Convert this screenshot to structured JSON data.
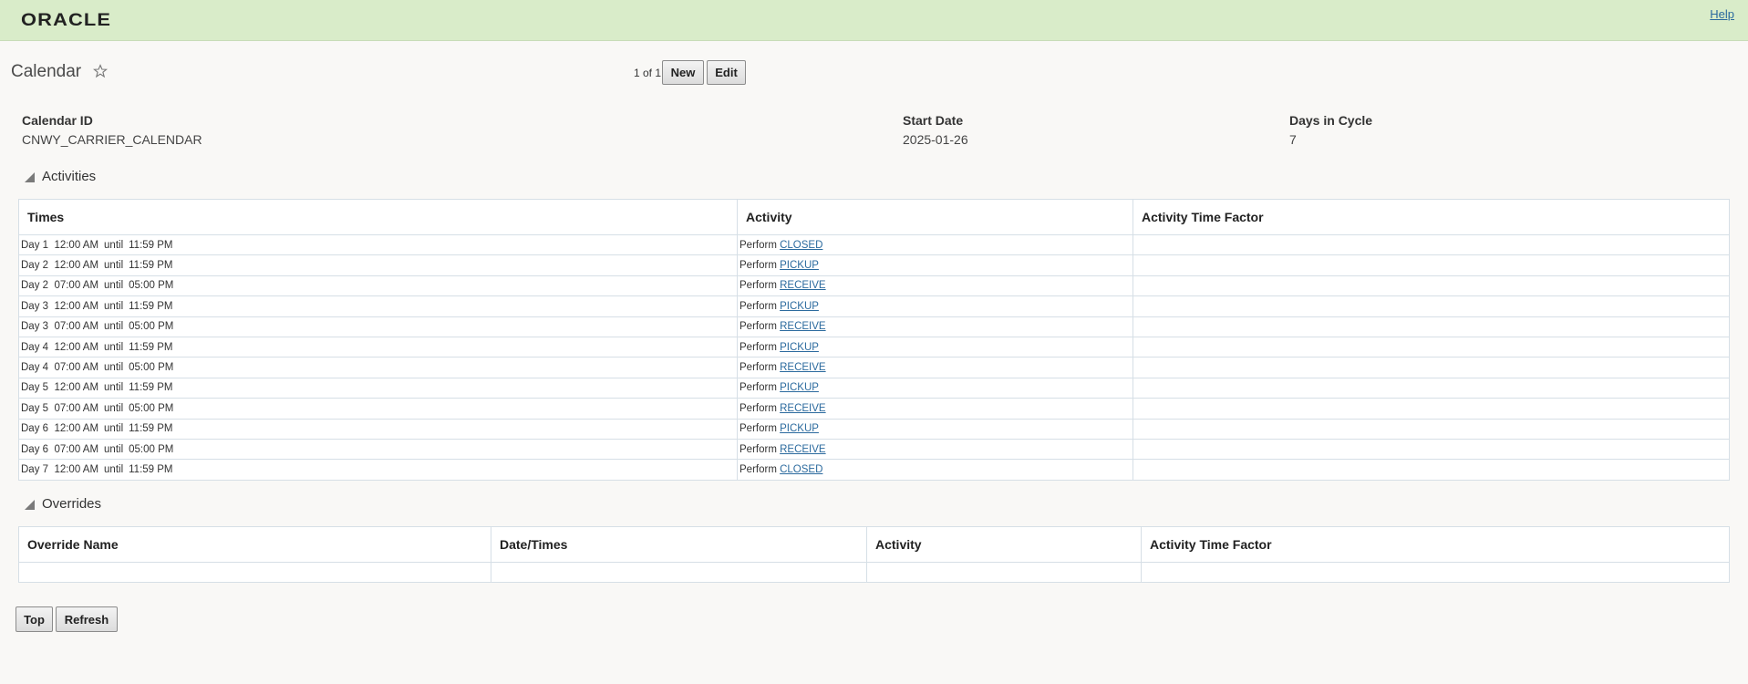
{
  "header": {
    "brand": "ORACLE",
    "help_label": "Help"
  },
  "page": {
    "title": "Calendar",
    "pager": "1 of 1",
    "new_label": "New",
    "edit_label": "Edit"
  },
  "fields": {
    "calendar_id_label": "Calendar ID",
    "calendar_id_value": "CNWY_CARRIER_CALENDAR",
    "start_date_label": "Start Date",
    "start_date_value": "2025-01-26",
    "days_in_cycle_label": "Days in Cycle",
    "days_in_cycle_value": "7"
  },
  "activities": {
    "section_title": "Activities",
    "columns": [
      "Times",
      "Activity",
      "Activity Time Factor"
    ],
    "rows": [
      {
        "day": "Day 1",
        "start": "12:00 AM",
        "until": "until",
        "end": "11:59 PM",
        "perform": "Perform",
        "activity": "CLOSED",
        "factor": ""
      },
      {
        "day": "Day 2",
        "start": "12:00 AM",
        "until": "until",
        "end": "11:59 PM",
        "perform": "Perform",
        "activity": "PICKUP",
        "factor": ""
      },
      {
        "day": "Day 2",
        "start": "07:00 AM",
        "until": "until",
        "end": "05:00 PM",
        "perform": "Perform",
        "activity": "RECEIVE",
        "factor": ""
      },
      {
        "day": "Day 3",
        "start": "12:00 AM",
        "until": "until",
        "end": "11:59 PM",
        "perform": "Perform",
        "activity": "PICKUP",
        "factor": ""
      },
      {
        "day": "Day 3",
        "start": "07:00 AM",
        "until": "until",
        "end": "05:00 PM",
        "perform": "Perform",
        "activity": "RECEIVE",
        "factor": ""
      },
      {
        "day": "Day 4",
        "start": "12:00 AM",
        "until": "until",
        "end": "11:59 PM",
        "perform": "Perform",
        "activity": "PICKUP",
        "factor": ""
      },
      {
        "day": "Day 4",
        "start": "07:00 AM",
        "until": "until",
        "end": "05:00 PM",
        "perform": "Perform",
        "activity": "RECEIVE",
        "factor": ""
      },
      {
        "day": "Day 5",
        "start": "12:00 AM",
        "until": "until",
        "end": "11:59 PM",
        "perform": "Perform",
        "activity": "PICKUP",
        "factor": ""
      },
      {
        "day": "Day 5",
        "start": "07:00 AM",
        "until": "until",
        "end": "05:00 PM",
        "perform": "Perform",
        "activity": "RECEIVE",
        "factor": ""
      },
      {
        "day": "Day 6",
        "start": "12:00 AM",
        "until": "until",
        "end": "11:59 PM",
        "perform": "Perform",
        "activity": "PICKUP",
        "factor": ""
      },
      {
        "day": "Day 6",
        "start": "07:00 AM",
        "until": "until",
        "end": "05:00 PM",
        "perform": "Perform",
        "activity": "RECEIVE",
        "factor": ""
      },
      {
        "day": "Day 7",
        "start": "12:00 AM",
        "until": "until",
        "end": "11:59 PM",
        "perform": "Perform",
        "activity": "CLOSED",
        "factor": ""
      }
    ]
  },
  "overrides": {
    "section_title": "Overrides",
    "columns": [
      "Override Name",
      "Date/Times",
      "Activity",
      "Activity Time Factor"
    ]
  },
  "footer": {
    "top_label": "Top",
    "refresh_label": "Refresh"
  },
  "colors": {
    "header_bg": "#d9ecc9",
    "link": "#2b6a9e",
    "page_bg": "#f9f8f6"
  }
}
